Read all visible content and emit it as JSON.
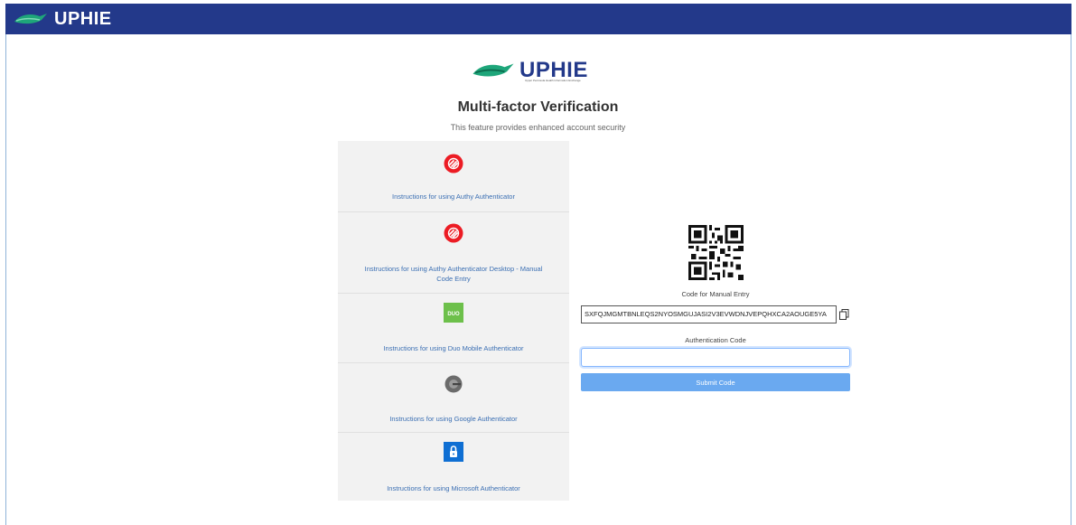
{
  "header": {
    "brand": "UPHIE",
    "colors": {
      "bar": "#23398a",
      "logo_green": "#1ea67a"
    }
  },
  "hero": {
    "brand": "UPHIE",
    "tagline": "Upper Peninsula Health Information Exchange",
    "title": "Multi-factor Verification",
    "subtitle": "This feature provides enhanced account security"
  },
  "options": [
    {
      "icon": "authy-icon",
      "label": "Instructions for using Authy Authenticator"
    },
    {
      "icon": "authy-icon",
      "label": "Instructions for using Authy Authenticator Desktop - Manual Code Entry"
    },
    {
      "icon": "duo-icon",
      "label": "Instructions for using Duo Mobile Authenticator"
    },
    {
      "icon": "google-authenticator-icon",
      "label": "Instructions for using Google Authenticator"
    },
    {
      "icon": "microsoft-authenticator-icon",
      "label": "Instructions for using Microsoft Authenticator"
    }
  ],
  "verify": {
    "manual_label": "Code for Manual Entry",
    "manual_code": "SXFQJMGMTBNLEQS2NYOSMGUJASI2V3EVWDNJVEPQHXCA2AOUGE5YA",
    "auth_label": "Authentication Code",
    "auth_value": "",
    "submit_label": "Submit Code"
  }
}
